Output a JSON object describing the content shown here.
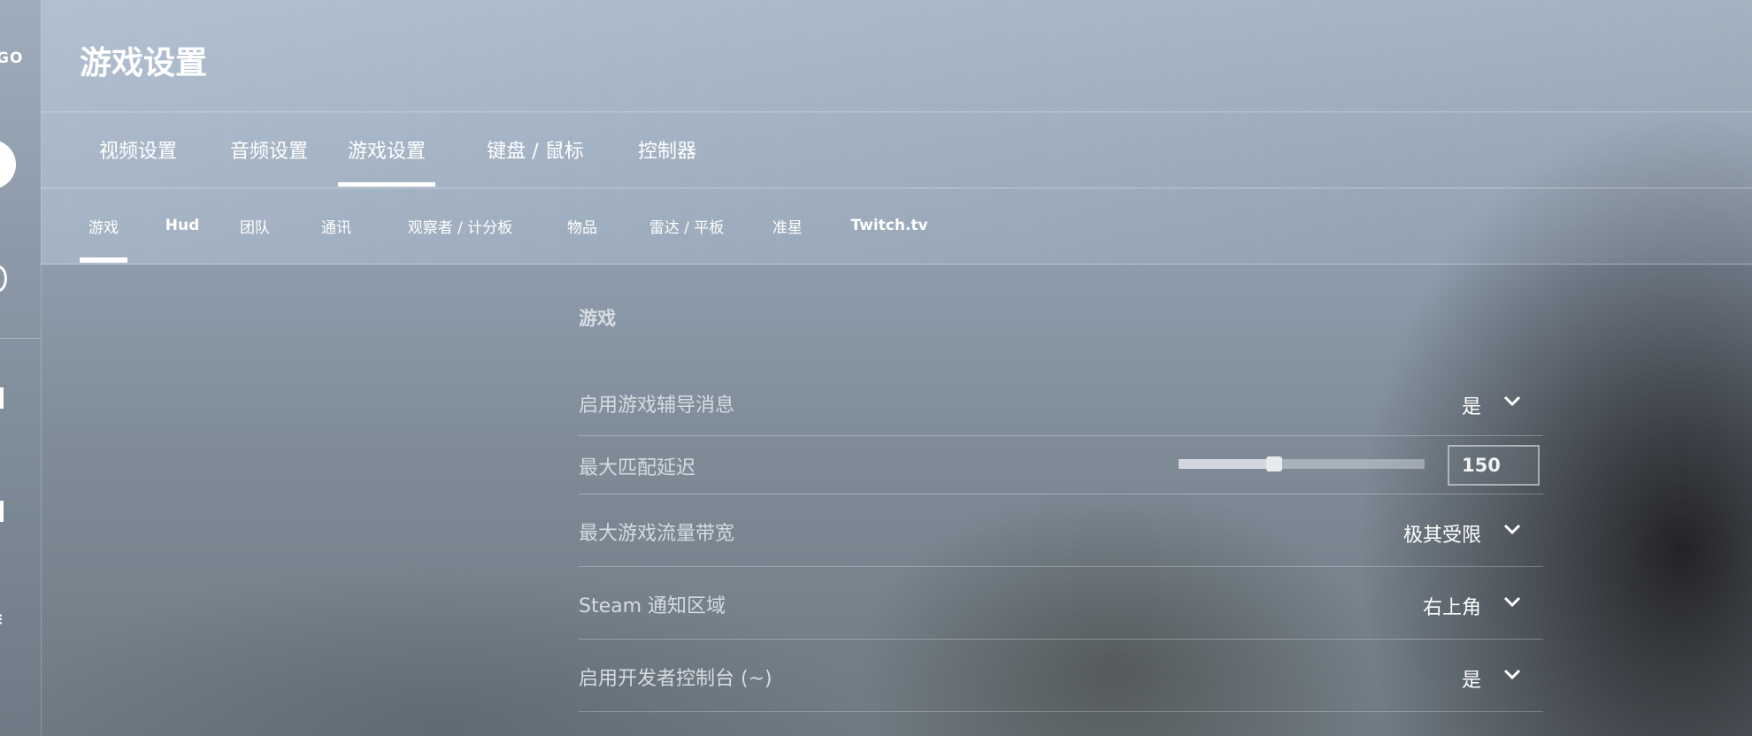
{
  "rail": {
    "logo_text": "GO"
  },
  "header": {
    "title": "游戏设置"
  },
  "tabs": [
    {
      "label": "视频设置",
      "active": false
    },
    {
      "label": "音频设置",
      "active": false
    },
    {
      "label": "游戏设置",
      "active": true
    },
    {
      "label": "键盘 / 鼠标",
      "active": false
    },
    {
      "label": "控制器",
      "active": false
    }
  ],
  "subtabs": [
    {
      "label": "游戏",
      "active": true
    },
    {
      "label": "Hud",
      "active": false
    },
    {
      "label": "团队",
      "active": false
    },
    {
      "label": "通讯",
      "active": false
    },
    {
      "label": "观察者 / 计分板",
      "active": false
    },
    {
      "label": "物品",
      "active": false
    },
    {
      "label": "雷达 / 平板",
      "active": false
    },
    {
      "label": "准星",
      "active": false
    },
    {
      "label": "Twitch.tv",
      "active": false
    }
  ],
  "section": {
    "title": "游戏"
  },
  "settings": {
    "game_instructor": {
      "label": "启用游戏辅导消息",
      "value": "是"
    },
    "max_ping": {
      "label": "最大匹配延迟",
      "value": "150",
      "slider_fraction": 0.39
    },
    "max_bandwidth": {
      "label": "最大游戏流量带宽",
      "value": "极其受限"
    },
    "steam_notify": {
      "label": "Steam 通知区域",
      "value": "右上角"
    },
    "dev_console": {
      "label": "启用开发者控制台 (~)",
      "value": "是"
    }
  },
  "icons": {
    "dropdown": "chevron-down-icon"
  },
  "colors": {
    "text_primary": "#ffffff",
    "text_label": "#d6dbe0"
  }
}
